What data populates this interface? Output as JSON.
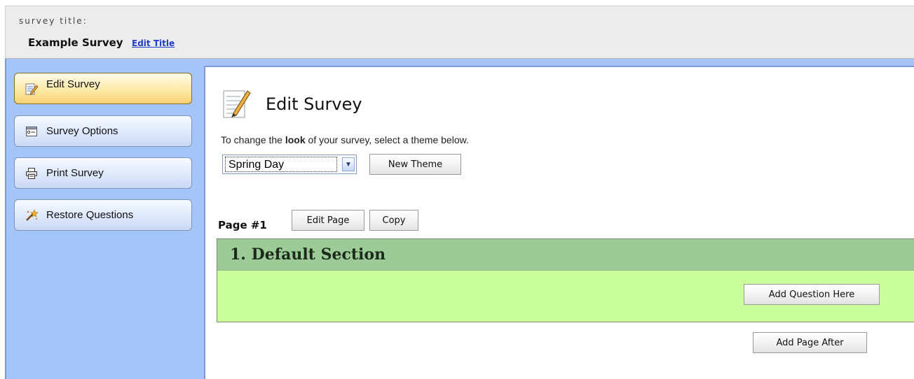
{
  "header": {
    "caption": "survey title:",
    "title": "Example Survey",
    "edit_title_link": "Edit Title"
  },
  "sidebar": {
    "items": [
      {
        "label": "Edit Survey",
        "icon": "edit-document-icon",
        "active": true
      },
      {
        "label": "Survey Options",
        "icon": "options-window-icon",
        "active": false
      },
      {
        "label": "Print Survey",
        "icon": "printer-icon",
        "active": false
      },
      {
        "label": "Restore Questions",
        "icon": "restore-magic-icon",
        "active": false
      }
    ]
  },
  "main": {
    "heading": "Edit Survey",
    "heading_icon": "edit-document-icon",
    "instruction_prefix": "To change the ",
    "instruction_bold": "look",
    "instruction_suffix": " of your survey, select a theme below.",
    "theme_select_value": "Spring Day",
    "new_theme_button": "New Theme",
    "page_label": "Page #1",
    "edit_page_button": "Edit Page",
    "copy_button": "Copy",
    "section_title": "1. Default Section",
    "add_question_button": "Add Question Here",
    "add_page_button": "Add Page After"
  },
  "colors": {
    "sidebar_bg": "#a5c4f7",
    "active_button": "#fde9a7",
    "section_header": "#9dcb97",
    "section_body": "#caff9b"
  }
}
